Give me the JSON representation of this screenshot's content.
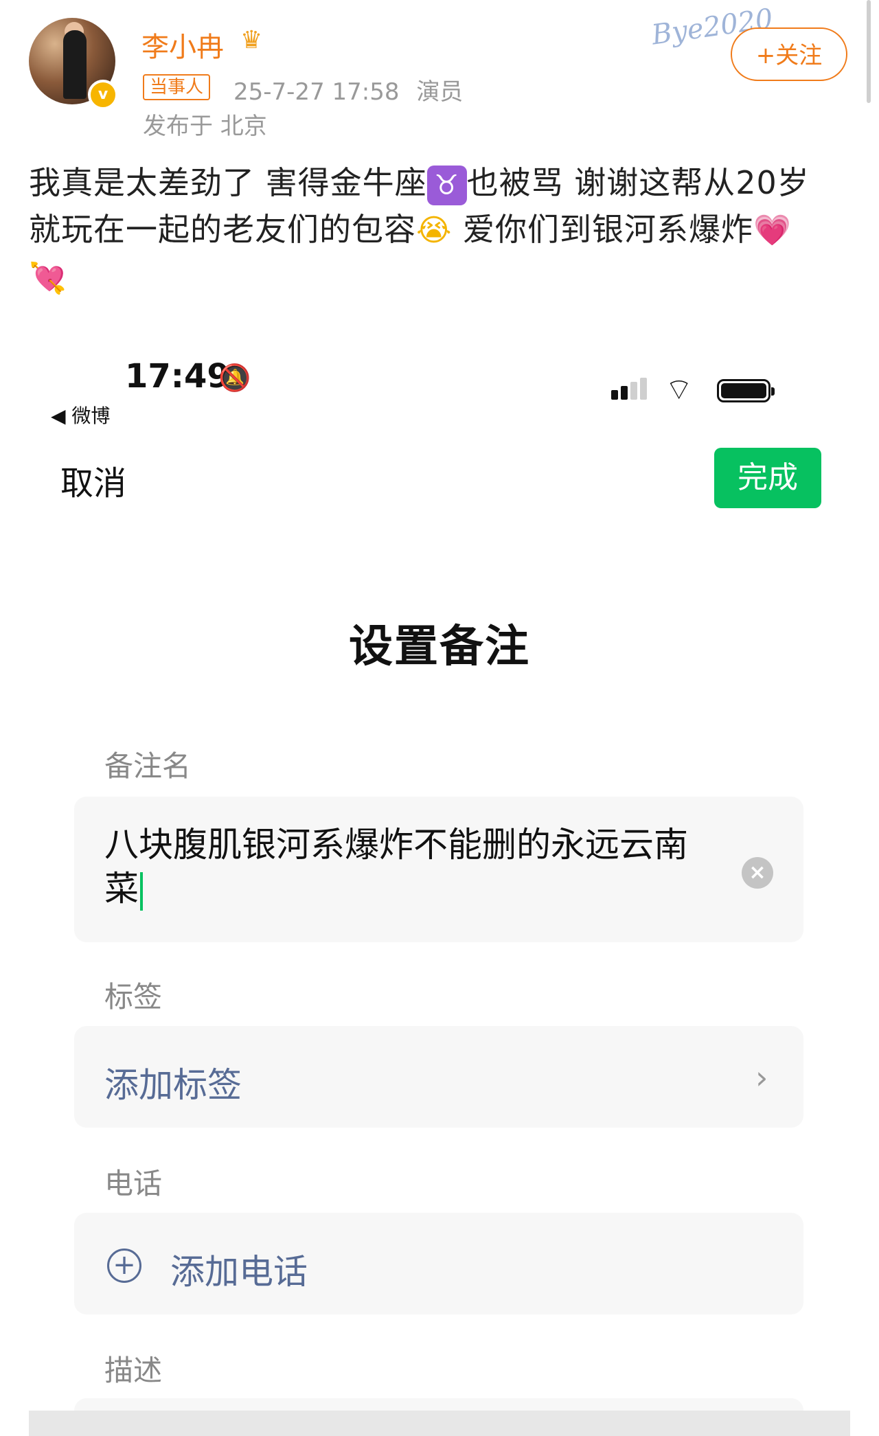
{
  "post": {
    "username": "李小冉",
    "crown_icon": "crown-icon",
    "tag": "当事人",
    "time": "25-7-27 17:58",
    "source": "演员",
    "location": "发布于 北京",
    "follow_label": "+关注",
    "sticker_text": "Bye2020",
    "text_part1": "我真是太差劲了 害得金牛座",
    "emoji_taurus": "♉",
    "text_part2": "也被骂 谢谢这帮从20岁就玩在一起的老友们的包容",
    "emoji_cry": "😭",
    "text_part3": " 爱你们到银河系爆炸",
    "emoji_heart1": "💗",
    "emoji_heart2": "💘"
  },
  "phone": {
    "status": {
      "time": "17:49",
      "back_app": "◀ 微博"
    },
    "nav": {
      "cancel_label": "取消",
      "done_label": "完成"
    },
    "title": "设置备注",
    "fields": {
      "remark_label": "备注名",
      "remark_value": "八块腹肌银河系爆炸不能删的永远云南菜",
      "tag_label": "标签",
      "tag_action": "添加标签",
      "phone_label": "电话",
      "phone_action": "添加电话",
      "desc_label": "描述"
    }
  },
  "colors": {
    "accent_orange": "#f07b1a",
    "wechat_green": "#07c160",
    "link_blue": "#576b95"
  }
}
